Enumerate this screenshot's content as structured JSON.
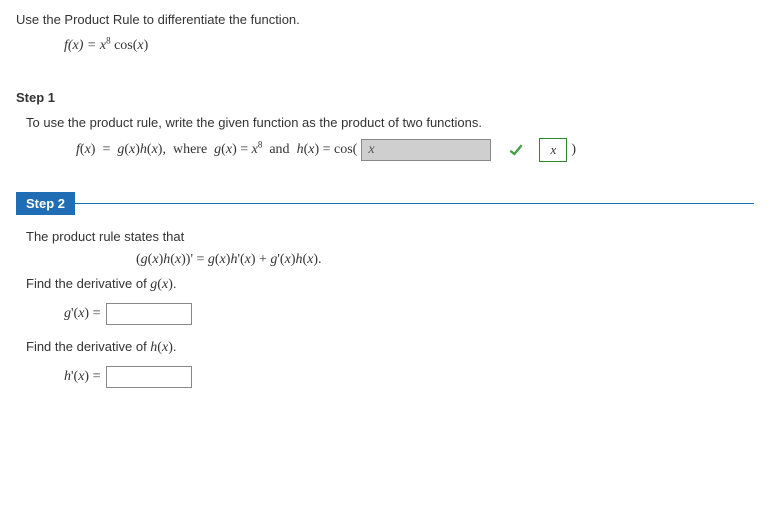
{
  "intro": "Use the Product Rule to differentiate the function.",
  "function": {
    "lhs": "f(x) = ",
    "base": "x",
    "exp": "8",
    "trail": " cos(x)"
  },
  "step1": {
    "title": "Step 1",
    "text": "To use the product rule, write the given function as the product of two functions.",
    "eq_pre": "f(x)  =  g(x)h(x),  where  g(x) = x",
    "eq_exp": "8",
    "eq_mid": "  and  h(x) = cos(",
    "input_value": "x",
    "eq_post": ")",
    "answer_display": "x"
  },
  "step2": {
    "title": "Step 2",
    "line1": "The product rule states that",
    "ruleeq": "(g(x)h(x))' = g(x)h'(x) + g'(x)h(x).",
    "prompt_g": "Find the derivative of g(x).",
    "glabel": "g'(x) = ",
    "g_value": "",
    "prompt_h": "Find the derivative of h(x).",
    "hlabel": "h'(x) = ",
    "h_value": ""
  }
}
